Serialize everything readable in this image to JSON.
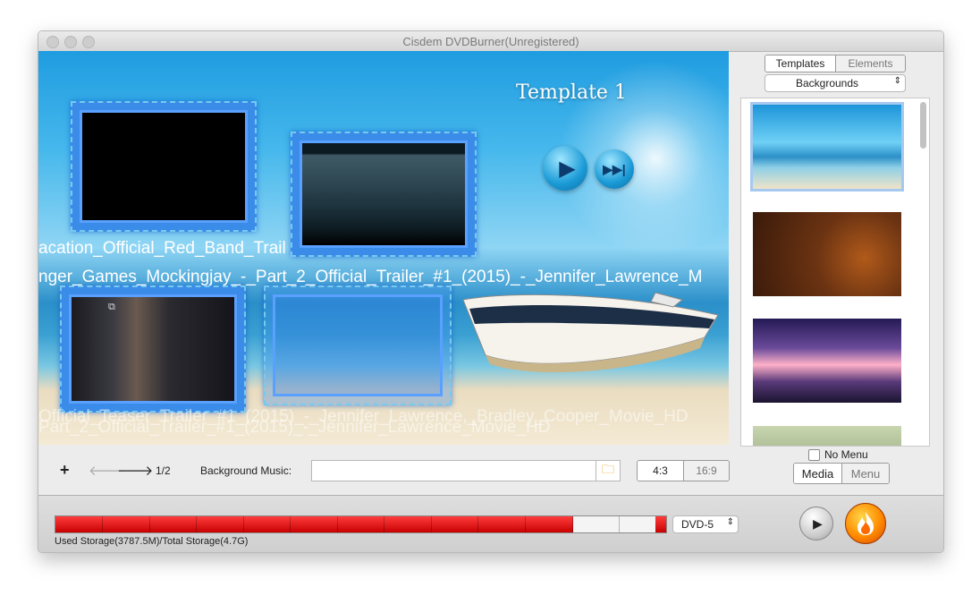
{
  "window": {
    "title": "Cisdem DVDBurner(Unregistered)"
  },
  "preview": {
    "template_title": "Template 1",
    "overlay_texts": [
      "acation_Official_Red_Band_Trail",
      "nger_Games_Mockingjay_-_Part_2_Official_Trailer_#1_(2015)_-_Jennifer_Lawrence_M",
      "Official_Teaser_Trailer_#1_(2015)_-_Jennifer_Lawrence,_Bradley_Cooper_Movie_HD",
      "Part_2_Official_Trailer_#1_(2015)_-_Jennifer_Lawrence_Movie_HD"
    ],
    "play_icon": "play-icon",
    "next_icon": "skip-forward-icon"
  },
  "toolbar": {
    "add": "+",
    "page": "1/2",
    "bg_music_label": "Background Music:",
    "bg_music_value": "",
    "aspect_4_3": "4:3",
    "aspect_16_9": "16:9"
  },
  "panel": {
    "tab_templates": "Templates",
    "tab_elements": "Elements",
    "category": "Backgrounds",
    "no_menu_label": "No Menu",
    "mode_media": "Media",
    "mode_menu": "Menu",
    "selected_thumb": 0
  },
  "storage": {
    "used_mb": 3787.5,
    "total_gb": 4.7,
    "used_fraction": 0.847,
    "label": "Used Storage(3787.5M)/Total Storage(4.7G)",
    "disc_type": "DVD-5"
  },
  "colors": {
    "accent_blue": "#3a8ce8",
    "storage_red": "#e00000",
    "burn_orange": "#ff8a00"
  }
}
